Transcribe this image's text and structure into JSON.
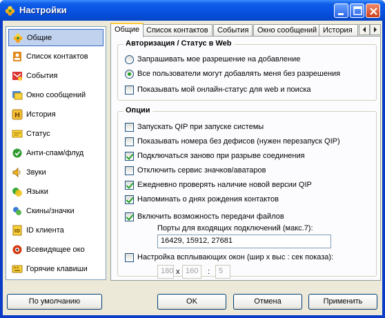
{
  "window": {
    "title": "Настройки",
    "colors": {
      "titlebar": "#0752e2",
      "face": "#ece9d8",
      "selection": "#c1d2ee",
      "check": "#21a121"
    }
  },
  "sidebar": {
    "items": [
      {
        "label": "Общие",
        "icon": "qip-flower-icon",
        "selected": true
      },
      {
        "label": "Список контактов",
        "icon": "contacts-list-icon"
      },
      {
        "label": "События",
        "icon": "events-icon"
      },
      {
        "label": "Окно сообщений",
        "icon": "message-window-icon"
      },
      {
        "label": "История",
        "icon": "history-icon"
      },
      {
        "label": "Статус",
        "icon": "status-icon"
      },
      {
        "label": "Анти-спам/флуд",
        "icon": "antispam-icon"
      },
      {
        "label": "Звуки",
        "icon": "speaker-icon"
      },
      {
        "label": "Языки",
        "icon": "languages-icon"
      },
      {
        "label": "Скины/значки",
        "icon": "skins-icon"
      },
      {
        "label": "ID клиента",
        "icon": "client-id-icon"
      },
      {
        "label": "Всевидящее око",
        "icon": "all-seeing-eye-icon"
      },
      {
        "label": "Горячие клавиши",
        "icon": "hotkeys-icon"
      }
    ]
  },
  "tabs": [
    "Общие",
    "Список контактов",
    "События",
    "Окно сообщений",
    "История"
  ],
  "auth": {
    "title": "Авторизация / Статус в Web",
    "radio_ask": "Запрашивать мое разрешение на добавление",
    "radio_all": "Все пользователи могут добавлять меня без разрешения",
    "web_status": "Показывать мой онлайн-статус для web и поиска"
  },
  "options": {
    "title": "Опции",
    "items": [
      {
        "label": "Запускать QIP при запуске системы",
        "checked": false
      },
      {
        "label": "Показывать номера без дефисов (нужен перезапуск QIP)",
        "checked": false
      },
      {
        "label": "Подключаться заново при разрыве соединения",
        "checked": true
      },
      {
        "label": "Отключить сервис значков/аватаров",
        "checked": false
      },
      {
        "label": "Ежедневно проверять наличие новой версии QIP",
        "checked": true
      },
      {
        "label": "Напоминать о днях рождения контактов",
        "checked": true
      }
    ],
    "file_transfer": "Включить возможность передачи файлов",
    "ports_label": "Порты для входящих подключений (макс.7):",
    "ports_value": "16429, 15912, 27681",
    "popup_label": "Настройка всплывающих окон (шир x выс : сек показа):",
    "popup_width": "180",
    "popup_x": "x",
    "popup_height": "160",
    "popup_colon": ":",
    "popup_seconds": "5"
  },
  "buttons": {
    "defaults": "По умолчанию",
    "ok": "OK",
    "cancel": "Отмена",
    "apply": "Применить"
  }
}
